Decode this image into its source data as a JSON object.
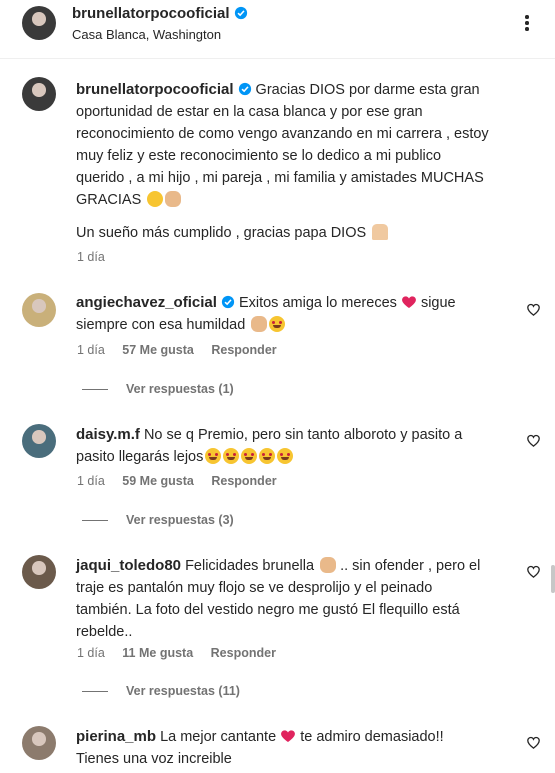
{
  "header": {
    "username": "brunellatorpocooficial",
    "location": "Casa Blanca, Washington"
  },
  "caption": {
    "username": "brunellatorpocooficial",
    "line1": "Gracias DIOS por darme esta gran",
    "line2": "oportunidad de estar en la casa blanca y por ese gran",
    "line3": "reconocimiento de como vengo avanzando en mi carrera , estoy",
    "line4": "muy feliz y este reconocimiento se lo dedico a mi publico",
    "line5": "querido , a mi hijo , mi pareja , mi familia y amistades MUCHAS",
    "line6": "GRACIAS",
    "line7": "Un sueño más cumplido , gracias papa DIOS",
    "time": "1 día"
  },
  "comments": [
    {
      "username": "angiechavez_oficial",
      "text1": "Exitos amiga lo mereces",
      "text1b": "sigue",
      "text2": "siempre con esa humildad",
      "time": "1 día",
      "likes": "57 Me gusta",
      "reply": "Responder",
      "view_replies": "Ver respuestas (1)"
    },
    {
      "username": "daisy.m.f",
      "text1": "No se q Premio, pero sin tanto alboroto y pasito a",
      "text2": "pasito llegarás lejos",
      "time": "1 día",
      "likes": "59 Me gusta",
      "reply": "Responder",
      "view_replies": "Ver respuestas (3)"
    },
    {
      "username": "jaqui_toledo80",
      "text1": "Felicidades brunella",
      "text1b": ".. sin ofender , pero el",
      "text2": "traje es pantalón muy flojo se ve desprolijo y el peinado",
      "text3": "también. La foto del vestido negro me gustó El flequillo está",
      "text4": "rebelde..",
      "time": "1 día",
      "likes": "11 Me gusta",
      "reply": "Responder",
      "view_replies": "Ver respuestas (11)"
    },
    {
      "username": "pierina_mb",
      "text1": "La mejor cantante",
      "text1b": "te admiro demasiado!!",
      "text2": "Tienes una voz increible"
    }
  ],
  "colors": {
    "verified": "#0095f6",
    "text": "#262626",
    "muted": "#737373",
    "heart": "#e0245e"
  }
}
